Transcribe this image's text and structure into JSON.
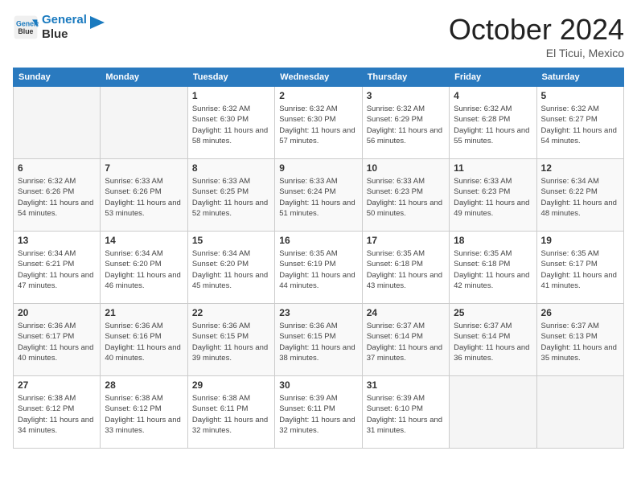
{
  "header": {
    "logo_line1": "General",
    "logo_line2": "Blue",
    "month_title": "October 2024",
    "location": "El Ticui, Mexico"
  },
  "weekdays": [
    "Sunday",
    "Monday",
    "Tuesday",
    "Wednesday",
    "Thursday",
    "Friday",
    "Saturday"
  ],
  "weeks": [
    [
      {
        "day": "",
        "empty": true
      },
      {
        "day": "",
        "empty": true
      },
      {
        "day": "1",
        "sunrise": "6:32 AM",
        "sunset": "6:30 PM",
        "daylight": "11 hours and 58 minutes."
      },
      {
        "day": "2",
        "sunrise": "6:32 AM",
        "sunset": "6:30 PM",
        "daylight": "11 hours and 57 minutes."
      },
      {
        "day": "3",
        "sunrise": "6:32 AM",
        "sunset": "6:29 PM",
        "daylight": "11 hours and 56 minutes."
      },
      {
        "day": "4",
        "sunrise": "6:32 AM",
        "sunset": "6:28 PM",
        "daylight": "11 hours and 55 minutes."
      },
      {
        "day": "5",
        "sunrise": "6:32 AM",
        "sunset": "6:27 PM",
        "daylight": "11 hours and 54 minutes."
      }
    ],
    [
      {
        "day": "6",
        "sunrise": "6:32 AM",
        "sunset": "6:26 PM",
        "daylight": "11 hours and 54 minutes."
      },
      {
        "day": "7",
        "sunrise": "6:33 AM",
        "sunset": "6:26 PM",
        "daylight": "11 hours and 53 minutes."
      },
      {
        "day": "8",
        "sunrise": "6:33 AM",
        "sunset": "6:25 PM",
        "daylight": "11 hours and 52 minutes."
      },
      {
        "day": "9",
        "sunrise": "6:33 AM",
        "sunset": "6:24 PM",
        "daylight": "11 hours and 51 minutes."
      },
      {
        "day": "10",
        "sunrise": "6:33 AM",
        "sunset": "6:23 PM",
        "daylight": "11 hours and 50 minutes."
      },
      {
        "day": "11",
        "sunrise": "6:33 AM",
        "sunset": "6:23 PM",
        "daylight": "11 hours and 49 minutes."
      },
      {
        "day": "12",
        "sunrise": "6:34 AM",
        "sunset": "6:22 PM",
        "daylight": "11 hours and 48 minutes."
      }
    ],
    [
      {
        "day": "13",
        "sunrise": "6:34 AM",
        "sunset": "6:21 PM",
        "daylight": "11 hours and 47 minutes."
      },
      {
        "day": "14",
        "sunrise": "6:34 AM",
        "sunset": "6:20 PM",
        "daylight": "11 hours and 46 minutes."
      },
      {
        "day": "15",
        "sunrise": "6:34 AM",
        "sunset": "6:20 PM",
        "daylight": "11 hours and 45 minutes."
      },
      {
        "day": "16",
        "sunrise": "6:35 AM",
        "sunset": "6:19 PM",
        "daylight": "11 hours and 44 minutes."
      },
      {
        "day": "17",
        "sunrise": "6:35 AM",
        "sunset": "6:18 PM",
        "daylight": "11 hours and 43 minutes."
      },
      {
        "day": "18",
        "sunrise": "6:35 AM",
        "sunset": "6:18 PM",
        "daylight": "11 hours and 42 minutes."
      },
      {
        "day": "19",
        "sunrise": "6:35 AM",
        "sunset": "6:17 PM",
        "daylight": "11 hours and 41 minutes."
      }
    ],
    [
      {
        "day": "20",
        "sunrise": "6:36 AM",
        "sunset": "6:17 PM",
        "daylight": "11 hours and 40 minutes."
      },
      {
        "day": "21",
        "sunrise": "6:36 AM",
        "sunset": "6:16 PM",
        "daylight": "11 hours and 40 minutes."
      },
      {
        "day": "22",
        "sunrise": "6:36 AM",
        "sunset": "6:15 PM",
        "daylight": "11 hours and 39 minutes."
      },
      {
        "day": "23",
        "sunrise": "6:36 AM",
        "sunset": "6:15 PM",
        "daylight": "11 hours and 38 minutes."
      },
      {
        "day": "24",
        "sunrise": "6:37 AM",
        "sunset": "6:14 PM",
        "daylight": "11 hours and 37 minutes."
      },
      {
        "day": "25",
        "sunrise": "6:37 AM",
        "sunset": "6:14 PM",
        "daylight": "11 hours and 36 minutes."
      },
      {
        "day": "26",
        "sunrise": "6:37 AM",
        "sunset": "6:13 PM",
        "daylight": "11 hours and 35 minutes."
      }
    ],
    [
      {
        "day": "27",
        "sunrise": "6:38 AM",
        "sunset": "6:12 PM",
        "daylight": "11 hours and 34 minutes."
      },
      {
        "day": "28",
        "sunrise": "6:38 AM",
        "sunset": "6:12 PM",
        "daylight": "11 hours and 33 minutes."
      },
      {
        "day": "29",
        "sunrise": "6:38 AM",
        "sunset": "6:11 PM",
        "daylight": "11 hours and 32 minutes."
      },
      {
        "day": "30",
        "sunrise": "6:39 AM",
        "sunset": "6:11 PM",
        "daylight": "11 hours and 32 minutes."
      },
      {
        "day": "31",
        "sunrise": "6:39 AM",
        "sunset": "6:10 PM",
        "daylight": "11 hours and 31 minutes."
      },
      {
        "day": "",
        "empty": true
      },
      {
        "day": "",
        "empty": true
      }
    ]
  ]
}
